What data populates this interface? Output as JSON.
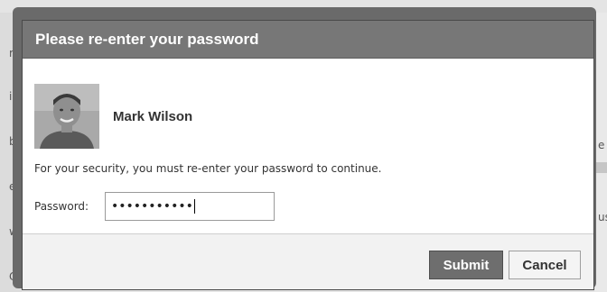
{
  "background": {
    "left_edge_letters": [
      "r",
      "i",
      "b",
      "e",
      "w",
      "C"
    ],
    "right_edge_letters": [
      "e",
      "us"
    ]
  },
  "dialog": {
    "title": "Please re-enter your password",
    "user": {
      "name": "Mark Wilson",
      "avatar_icon": "user-photo"
    },
    "message": "For your security, you must re-enter your password to continue.",
    "password": {
      "label": "Password:",
      "value": "•••••••••••"
    },
    "buttons": {
      "submit_label": "Submit",
      "cancel_label": "Cancel"
    }
  },
  "colors": {
    "header_bg": "#777777",
    "submit_bg": "#6e6e6e",
    "footer_bg": "#f2f2f2"
  }
}
